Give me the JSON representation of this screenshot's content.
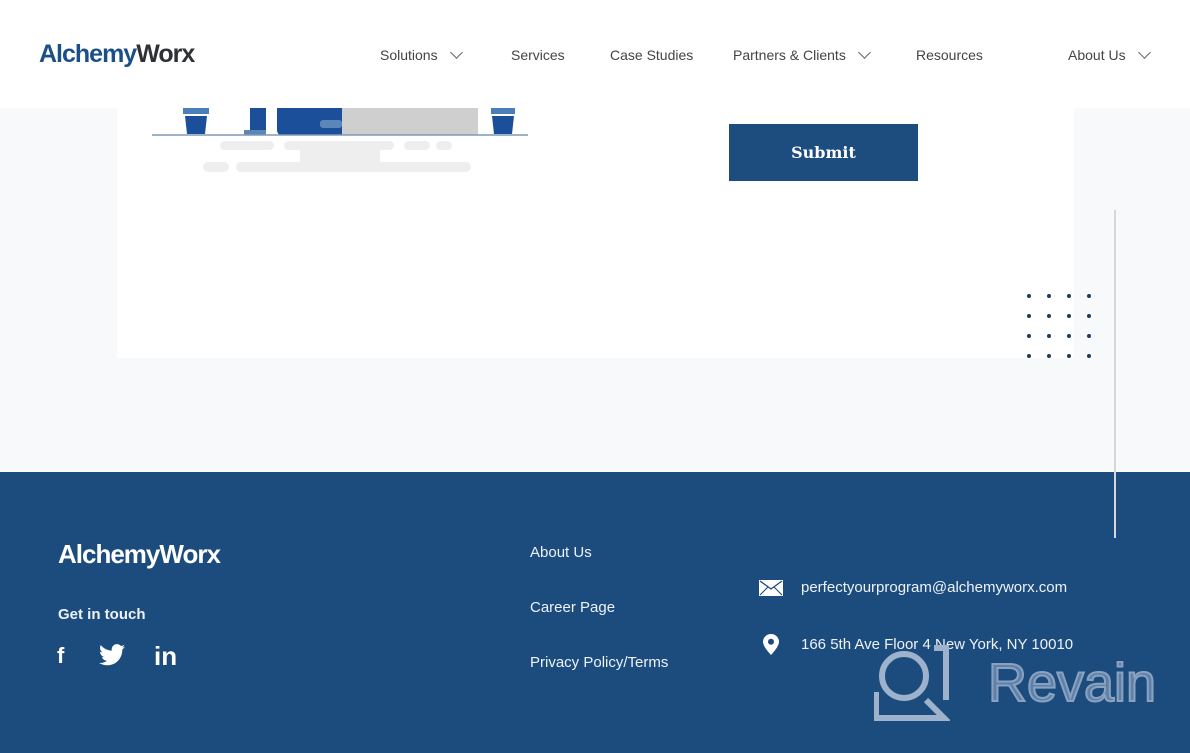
{
  "header": {
    "logo": {
      "part1": "Alchemy",
      "part2": "Worx"
    },
    "nav": [
      {
        "label": "Solutions",
        "has_dropdown": true
      },
      {
        "label": "Services",
        "has_dropdown": false
      },
      {
        "label": "Case Studies",
        "has_dropdown": false
      },
      {
        "label": "Partners & Clients",
        "has_dropdown": true
      },
      {
        "label": "Resources",
        "has_dropdown": false
      },
      {
        "label": "About Us",
        "has_dropdown": true
      }
    ]
  },
  "form": {
    "submit_label": "Submit"
  },
  "colors": {
    "brand_blue": "#1c4c7e",
    "logo_dark": "#2f3136",
    "page_bg": "#f8f9fb"
  },
  "footer": {
    "logo": "AlchemyWorx",
    "get_in_touch": "Get in touch",
    "social": [
      {
        "name": "facebook",
        "glyph": "f"
      },
      {
        "name": "twitter",
        "glyph": "🐦"
      },
      {
        "name": "linkedin",
        "glyph": "in"
      }
    ],
    "links": [
      "About Us",
      "Career Page",
      "Privacy Policy/Terms"
    ],
    "contact": {
      "email": "perfectyourprogram@alchemyworx.com",
      "address": "166 5th Ave Floor 4 New York, NY 10010"
    },
    "watermark": "Revain"
  }
}
